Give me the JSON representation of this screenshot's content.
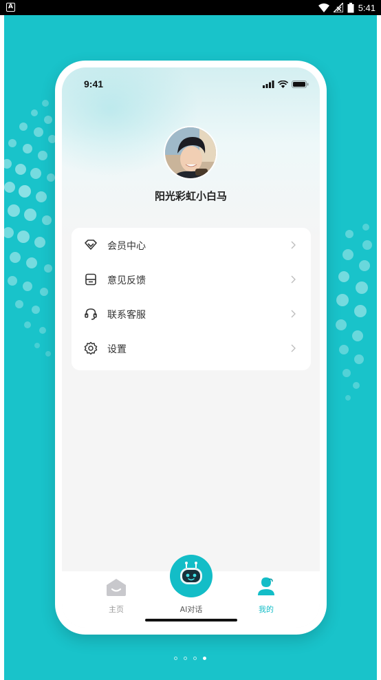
{
  "system_bar": {
    "app_badge": "A",
    "time": "5:41",
    "battery_level": "5"
  },
  "phone_status": {
    "time": "9:41"
  },
  "profile": {
    "username": "阳光彩虹小白马"
  },
  "menu": {
    "items": [
      {
        "label": "会员中心",
        "icon": "diamond-icon"
      },
      {
        "label": "意见反馈",
        "icon": "feedback-icon"
      },
      {
        "label": "联系客服",
        "icon": "headset-icon"
      },
      {
        "label": "设置",
        "icon": "gear-icon"
      }
    ]
  },
  "tabbar": {
    "home_label": "主页",
    "ai_label": "AI对话",
    "mine_label": "我的",
    "active_color": "#13bdc7",
    "inactive_color": "#999999"
  },
  "pager": {
    "count": 4,
    "active_index": 3
  },
  "colors": {
    "background": "#19c3ca",
    "accent": "#13bdc7"
  }
}
